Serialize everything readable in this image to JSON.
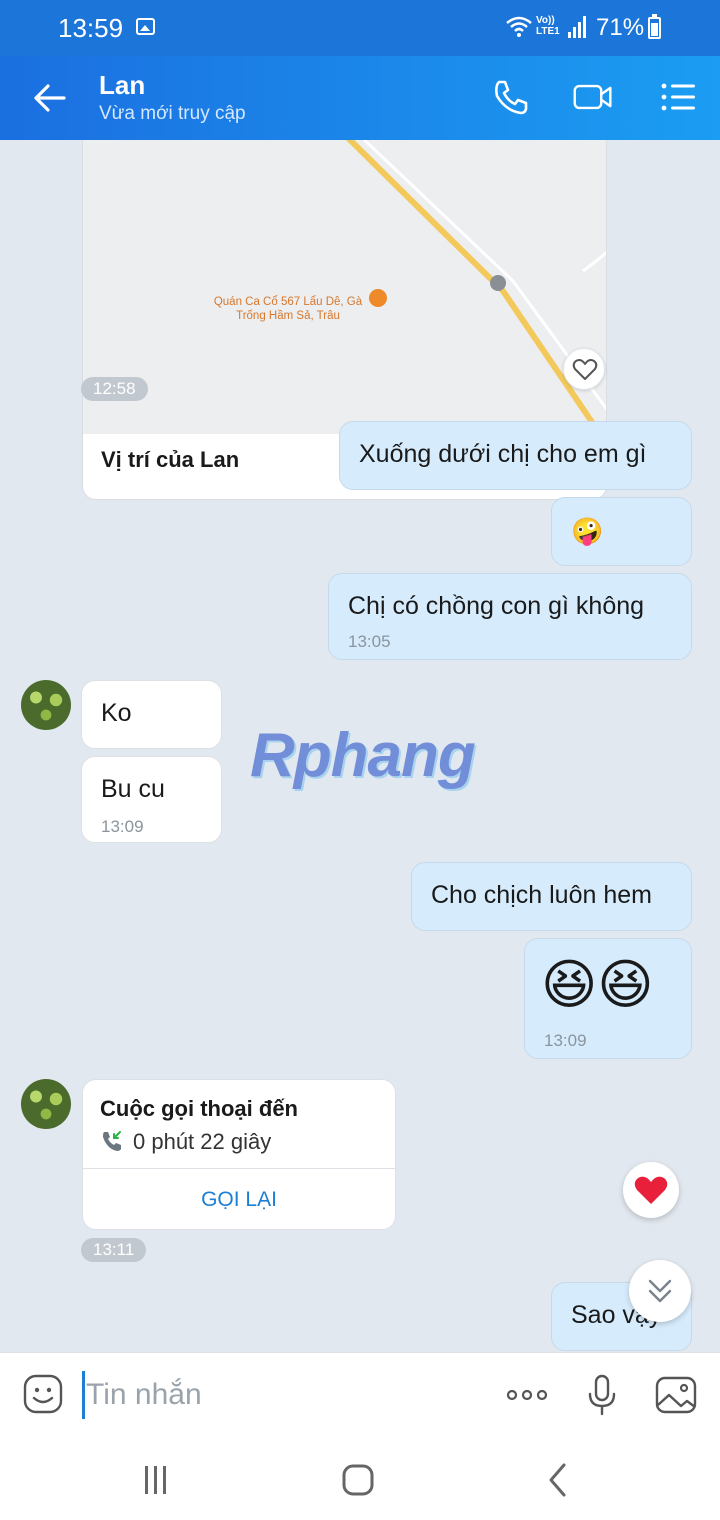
{
  "status_bar": {
    "time": "13:59",
    "network": "VoLTE LTE1",
    "battery_percent": "71%"
  },
  "header": {
    "contact_name": "Lan",
    "contact_status": "Vừa mới truy cập"
  },
  "messages": {
    "location": {
      "poi_name": "Quán Ca Cổ 567 Lẩu Dê, Gà Trống Hầm Sả, Trâu",
      "title": "Vị trí của Lan",
      "time": "12:58"
    },
    "out1": {
      "text": "Xuống dưới chị cho em gì"
    },
    "out2": {
      "text": "🤪"
    },
    "out3": {
      "text": "Chị có chồng con gì không",
      "time": "13:05"
    },
    "in1": {
      "text": "Ko"
    },
    "in2": {
      "text": "Bu cu",
      "time": "13:09"
    },
    "out4": {
      "text": "Cho chịch luôn hem"
    },
    "out5": {
      "text": "😆😆",
      "time": "13:09"
    },
    "call": {
      "title": "Cuộc gọi thoại đến",
      "duration": "0 phút 22 giây",
      "action": "GỌI LẠI",
      "time": "13:11"
    },
    "out6": {
      "text": "Sao vậy"
    }
  },
  "watermark": "Rphang",
  "composer": {
    "placeholder": "Tin nhắn"
  },
  "colors": {
    "header_blue": "#1b6fe0",
    "outgoing_bubble": "#d6ecfd",
    "incoming_bubble": "#ffffff",
    "chat_background": "#e2e8ef",
    "link_blue": "#1b7fd3"
  },
  "icons": [
    "back-arrow-icon",
    "phone-icon",
    "video-call-icon",
    "menu-list-icon",
    "heart-outline-icon",
    "heart-filled-icon",
    "incoming-call-icon",
    "chevron-double-down-icon",
    "emoji-icon",
    "more-dots-icon",
    "microphone-icon",
    "image-icon",
    "nav-recents-icon",
    "nav-home-icon",
    "nav-back-icon"
  ]
}
